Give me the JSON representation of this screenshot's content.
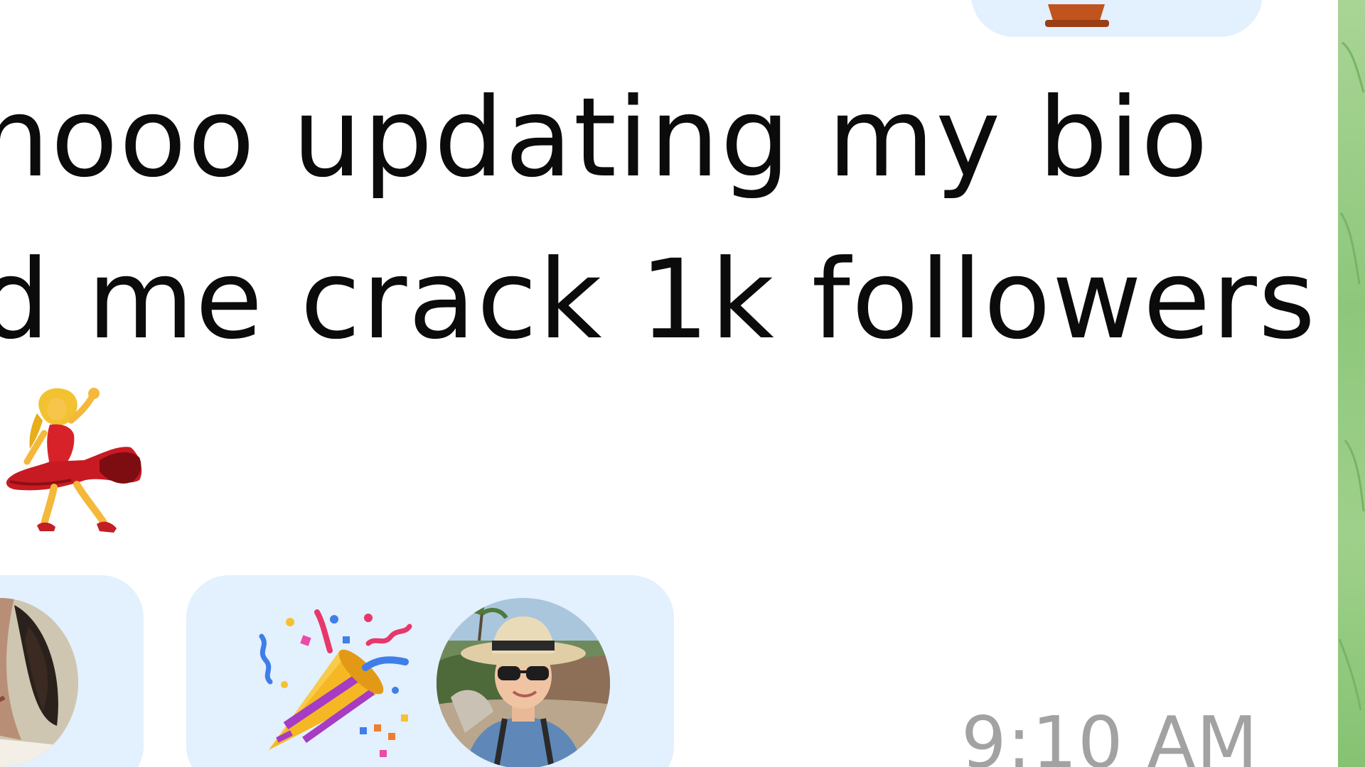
{
  "message": {
    "lines": [
      "hooo updating my bio",
      "d me crack 1k followers"
    ],
    "emoji_icon": "woman-dancing-icon"
  },
  "reactions": [
    {
      "emoji_icon": "",
      "reactor_avatar": "avatar"
    },
    {
      "emoji_icon": "party-popper-icon",
      "reactor_avatar": "avatar"
    }
  ],
  "timestamp": "9:10 AM",
  "colors": {
    "bubble": "#ffffff",
    "reaction_pill": "#e3f0fd",
    "text": "#0b0b0b",
    "timestamp": "#a2a2a2",
    "chat_background": "#9fd08b"
  }
}
